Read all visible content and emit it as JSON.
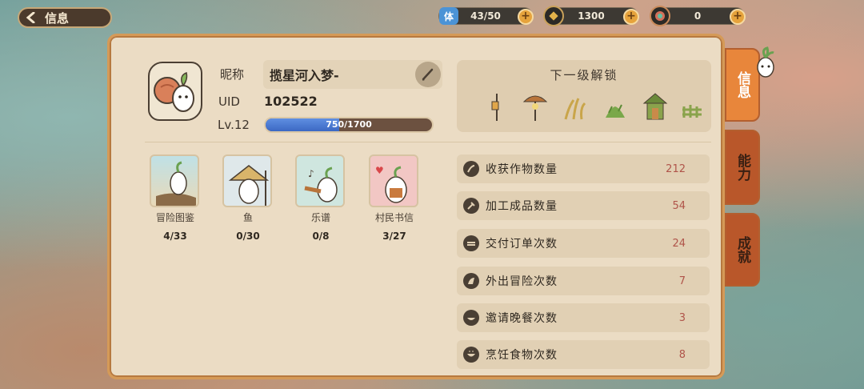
{
  "header": {
    "back_label": "信息"
  },
  "resources": {
    "stamina": {
      "icon_text": "体",
      "value": "43/50"
    },
    "coins": {
      "value": "1300"
    },
    "gems": {
      "value": "0"
    }
  },
  "profile": {
    "nickname_label": "昵称",
    "nickname": "揽星河入梦-",
    "uid_label": "UID",
    "uid": "102522",
    "level_label": "Lv.12",
    "xp_text": "750/1700",
    "xp_fraction": 0.441
  },
  "collections": [
    {
      "name": "冒险图鉴",
      "value": "4/33"
    },
    {
      "name": "鱼",
      "value": "0/30"
    },
    {
      "name": "乐谱",
      "value": "0/8"
    },
    {
      "name": "村民书信",
      "value": "3/27"
    }
  ],
  "unlock": {
    "title": "下一级解锁",
    "items": [
      "lamp-post-icon",
      "mushroom-lamp-icon",
      "wheat-crop-icon",
      "grass-crop-icon",
      "shrine-icon",
      "fence-icon"
    ]
  },
  "stats": [
    {
      "label": "收获作物数量",
      "value": "212",
      "icon": "harvest-icon"
    },
    {
      "label": "加工成品数量",
      "value": "54",
      "icon": "hammer-icon"
    },
    {
      "label": "交付订单次数",
      "value": "24",
      "icon": "order-icon"
    },
    {
      "label": "外出冒险次数",
      "value": "7",
      "icon": "adventure-icon"
    },
    {
      "label": "邀请晚餐次数",
      "value": "3",
      "icon": "dinner-icon"
    },
    {
      "label": "烹饪食物次数",
      "value": "8",
      "icon": "cooking-icon"
    }
  ],
  "tabs": [
    {
      "label": "信息",
      "active": true
    },
    {
      "label": "能力",
      "active": false
    },
    {
      "label": "成就",
      "active": false
    }
  ],
  "colors": {
    "accent": "#e8863b",
    "panel": "#ebdcc4",
    "value_red": "#b0544a",
    "xp_blue": "#4a78d2"
  }
}
